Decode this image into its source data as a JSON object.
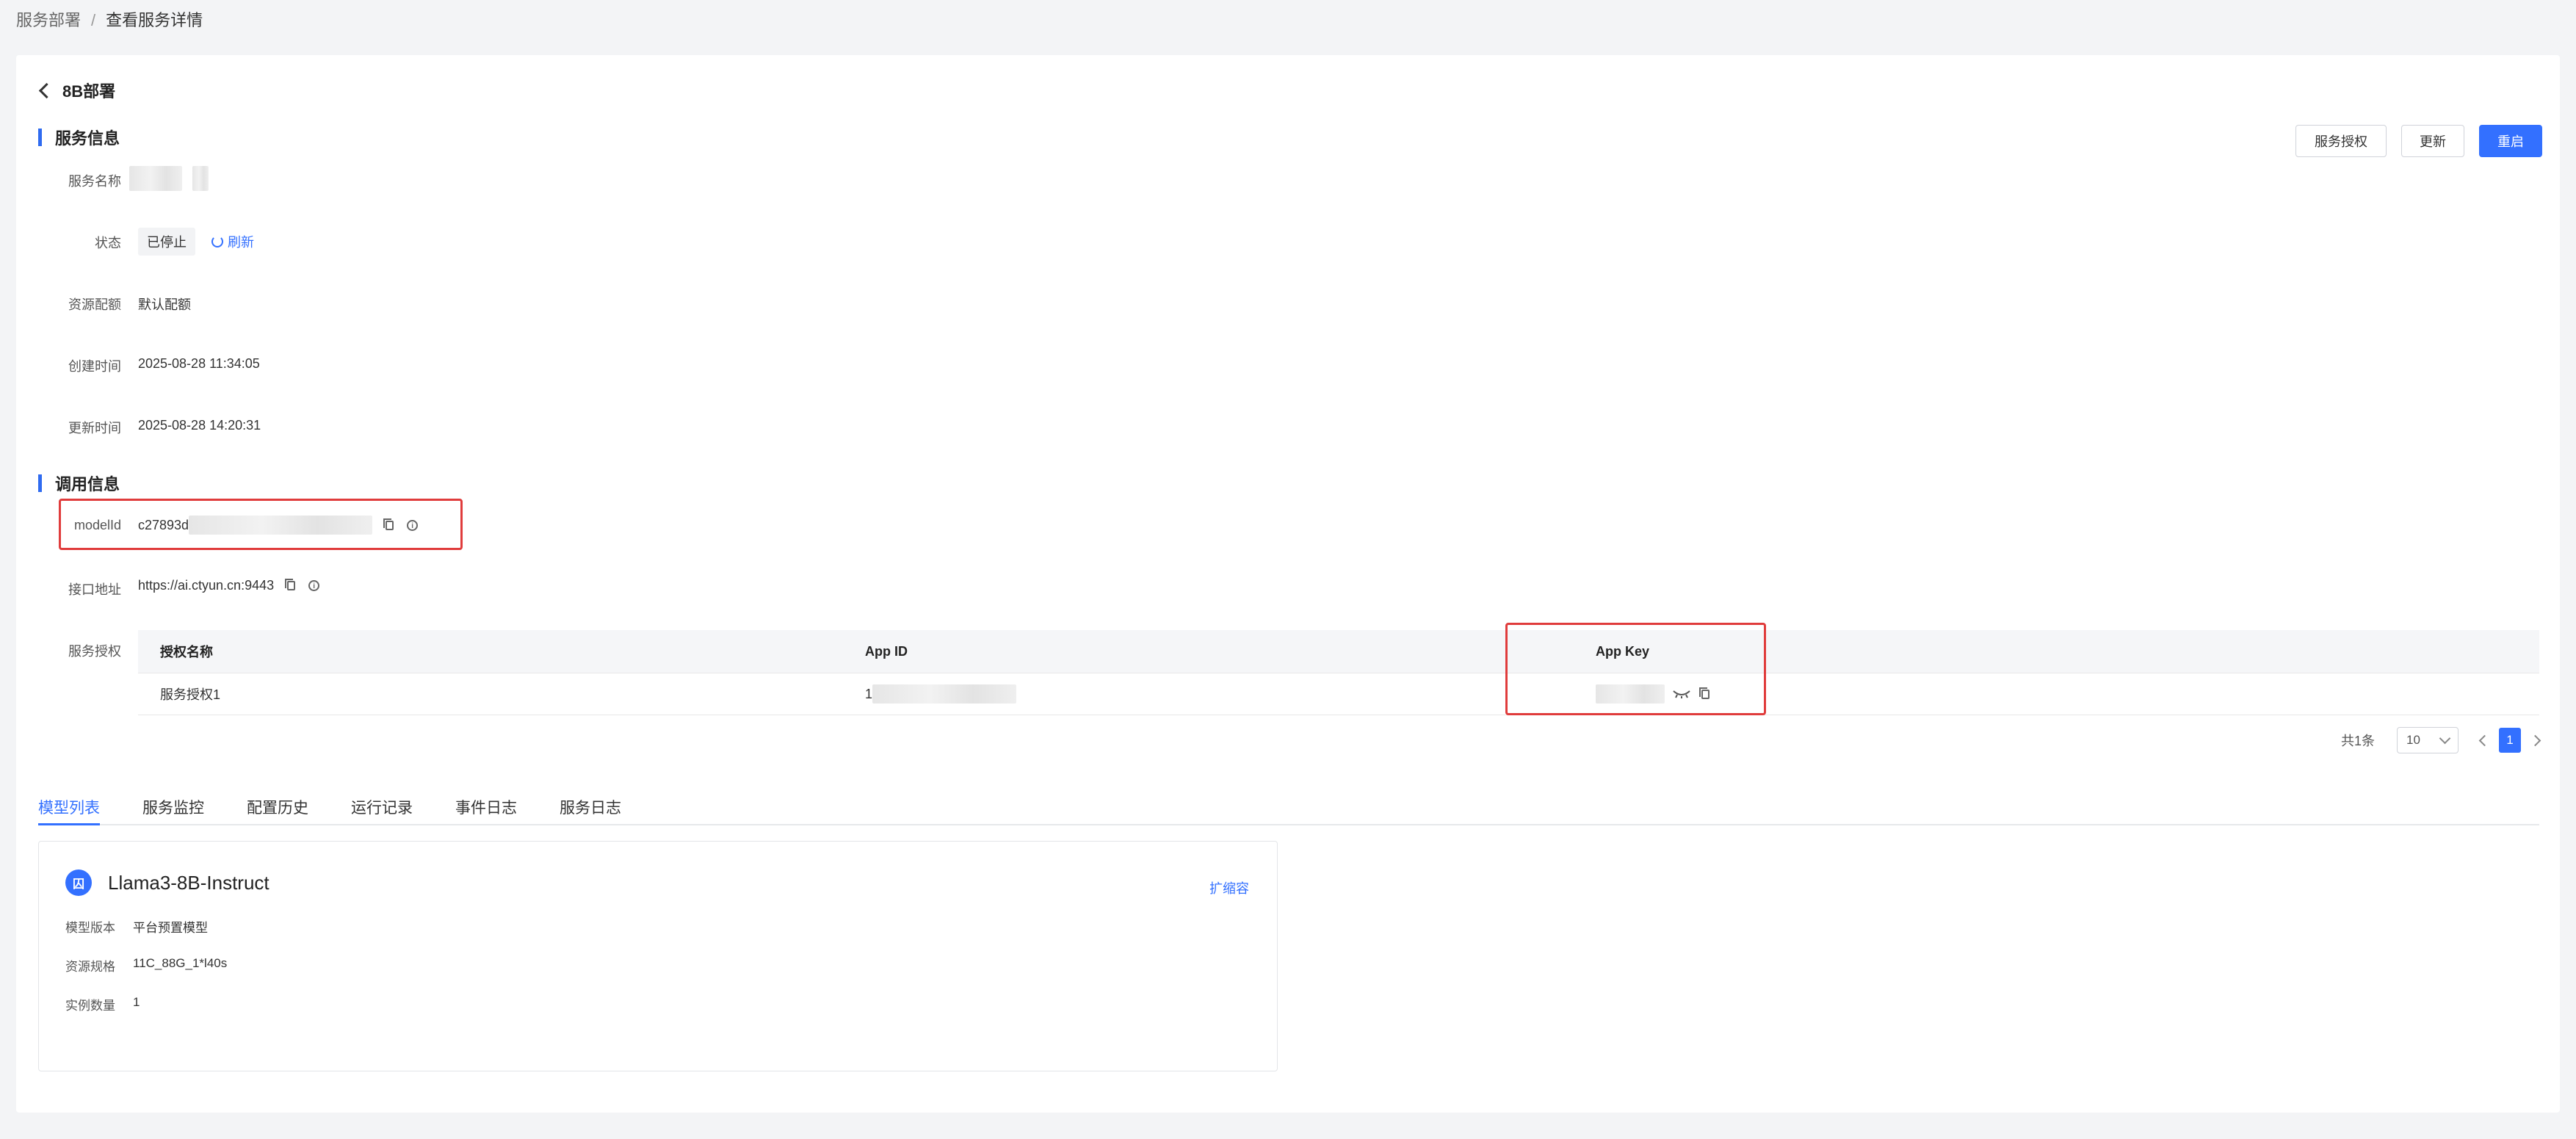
{
  "breadcrumb": {
    "parent": "服务部署",
    "separator": "/",
    "current": "查看服务详情"
  },
  "header": {
    "title": "8B部署"
  },
  "actions": {
    "authorize": "服务授权",
    "update": "更新",
    "restart": "重启"
  },
  "service_info": {
    "section_title": "服务信息",
    "name_label": "服务名称",
    "status_label": "状态",
    "status_value": "已停止",
    "refresh_label": "刷新",
    "quota_label": "资源配额",
    "quota_value": "默认配额",
    "created_label": "创建时间",
    "created_value": "2025-08-28 11:34:05",
    "updated_label": "更新时间",
    "updated_value": "2025-08-28 14:20:31"
  },
  "invoke_info": {
    "section_title": "调用信息",
    "modelid_label": "modelId",
    "modelid_value": "c27893d",
    "endpoint_label": "接口地址",
    "endpoint_value": "https://ai.ctyun.cn:9443",
    "auth_label": "服务授权"
  },
  "auth_table": {
    "columns": [
      "授权名称",
      "App ID",
      "App Key"
    ],
    "rows": [
      {
        "name": "服务授权1",
        "app_id": "1",
        "app_key": ""
      }
    ]
  },
  "pagination": {
    "total": "共1条",
    "page_size": "10",
    "current_page": "1"
  },
  "tabs": [
    "模型列表",
    "服务监控",
    "配置历史",
    "运行记录",
    "事件日志",
    "服务日志"
  ],
  "model_card": {
    "icon_glyph": "囚",
    "title": "Llama3-8B-Instruct",
    "scale_link": "扩缩容",
    "version_label": "模型版本",
    "version_value": "平台预置模型",
    "spec_label": "资源规格",
    "spec_value": "11C_88G_1*l40s",
    "count_label": "实例数量",
    "count_value": "1"
  },
  "colors": {
    "accent": "#3370ff",
    "highlight_box": "#e03c3c",
    "page_bg": "#f3f4f6"
  },
  "icons": [
    "back-chevron-icon",
    "refresh-icon",
    "copy-icon",
    "info-icon",
    "eye-closed-icon",
    "chevron-left-icon",
    "chevron-right-icon",
    "chevron-down-icon",
    "model-icon"
  ]
}
